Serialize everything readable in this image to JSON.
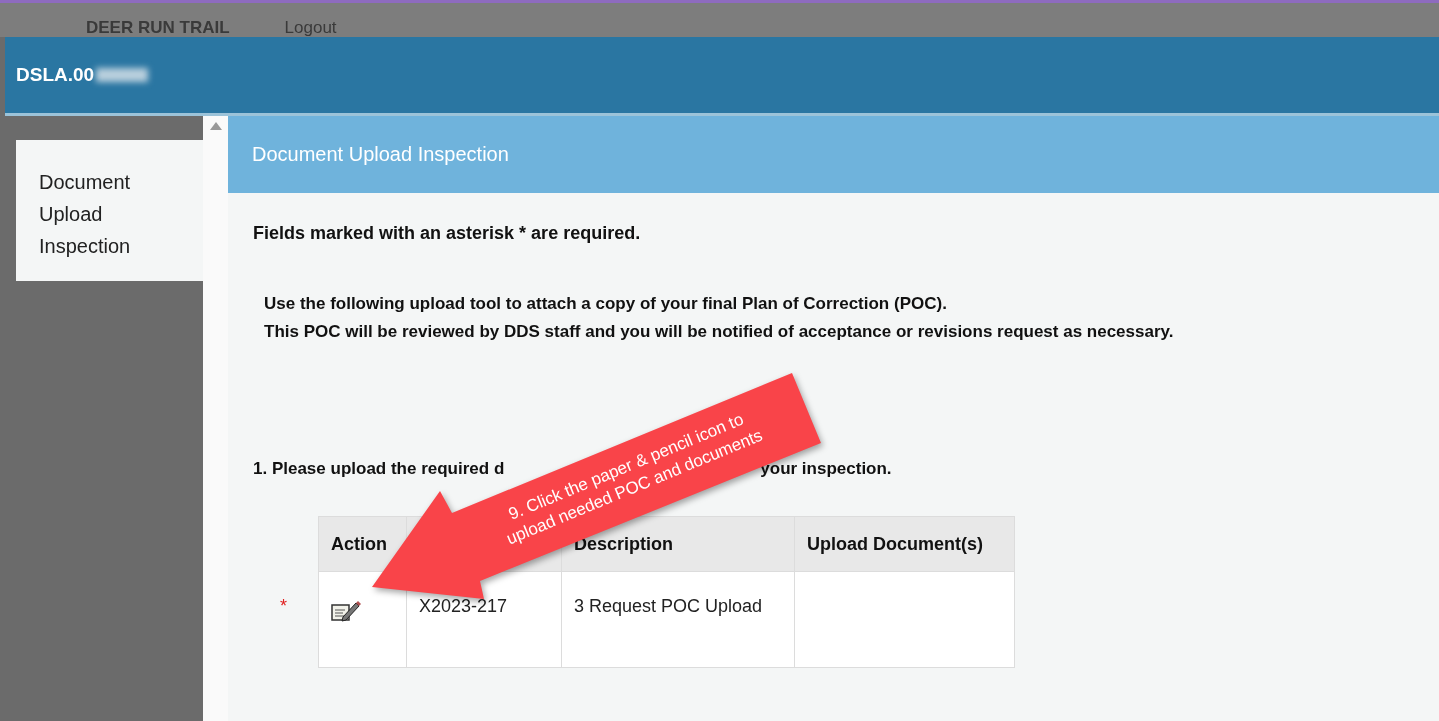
{
  "top_bar": {
    "site": "DEER RUN TRAIL",
    "logout": "Logout"
  },
  "header": {
    "title": "DSLA.00"
  },
  "sidebar": {
    "items": [
      {
        "label": "Document Upload Inspection",
        "selected": true
      }
    ]
  },
  "page_title": "Document Upload Inspection",
  "required_note": "Fields marked with an asterisk * are required.",
  "intro_lines": [
    "Use the following upload tool to attach a copy of your final Plan of Correction (POC).",
    "This POC will be reviewed by DDS staff and you will be notified of acceptance or revisions request as necessary."
  ],
  "step": {
    "before": "1. Please upload the required d",
    "after": "your inspection."
  },
  "table": {
    "columns": [
      "Action",
      "",
      "Description",
      "Upload Document(s)"
    ],
    "rows": [
      {
        "required_mark": "*",
        "column_2": "X2023-217",
        "description": "3 Request POC Upload",
        "upload": ""
      }
    ]
  },
  "callout": {
    "lines": [
      "9. Click the paper & pencil icon to",
      "upload needed POC and documents"
    ]
  }
}
